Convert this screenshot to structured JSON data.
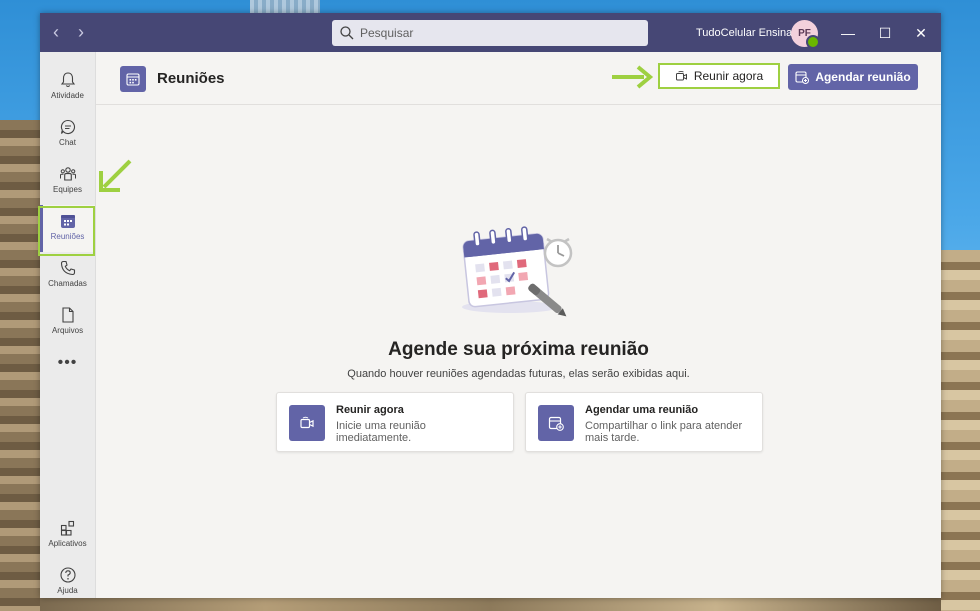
{
  "titlebar": {
    "search_placeholder": "Pesquisar",
    "user_name": "TudoCelular Ensina",
    "avatar_initials": "PF",
    "nav_back": "‹",
    "nav_forward": "›",
    "minimize": "—",
    "maximize": "☐",
    "close": "✕"
  },
  "rail": {
    "items": [
      {
        "label": "Atividade",
        "icon": "bell-icon"
      },
      {
        "label": "Chat",
        "icon": "chat-icon"
      },
      {
        "label": "Equipes",
        "icon": "teams-icon"
      },
      {
        "label": "Reuniões",
        "icon": "calendar-icon"
      },
      {
        "label": "Chamadas",
        "icon": "phone-icon"
      },
      {
        "label": "Arquivos",
        "icon": "file-icon"
      }
    ],
    "more": "•••",
    "bottom_items": [
      {
        "label": "Aplicativos",
        "icon": "apps-icon"
      },
      {
        "label": "Ajuda",
        "icon": "help-icon"
      }
    ],
    "active": "Reuniões"
  },
  "header": {
    "title": "Reuniões",
    "meet_now": "Reunir agora",
    "schedule": "Agendar reunião"
  },
  "empty_state": {
    "title": "Agende sua próxima reunião",
    "subtitle": "Quando houver reuniões agendadas futuras, elas serão exibidas aqui."
  },
  "cards": [
    {
      "title": "Reunir agora",
      "desc": "Inicie uma reunião imediatamente."
    },
    {
      "title": "Agendar uma reunião",
      "desc": "Compartilhar o link para atender mais tarde."
    }
  ],
  "colors": {
    "titlebar": "#464775",
    "accent": "#6264a7",
    "highlight": "#9ed041",
    "presence": "#6bb700"
  }
}
